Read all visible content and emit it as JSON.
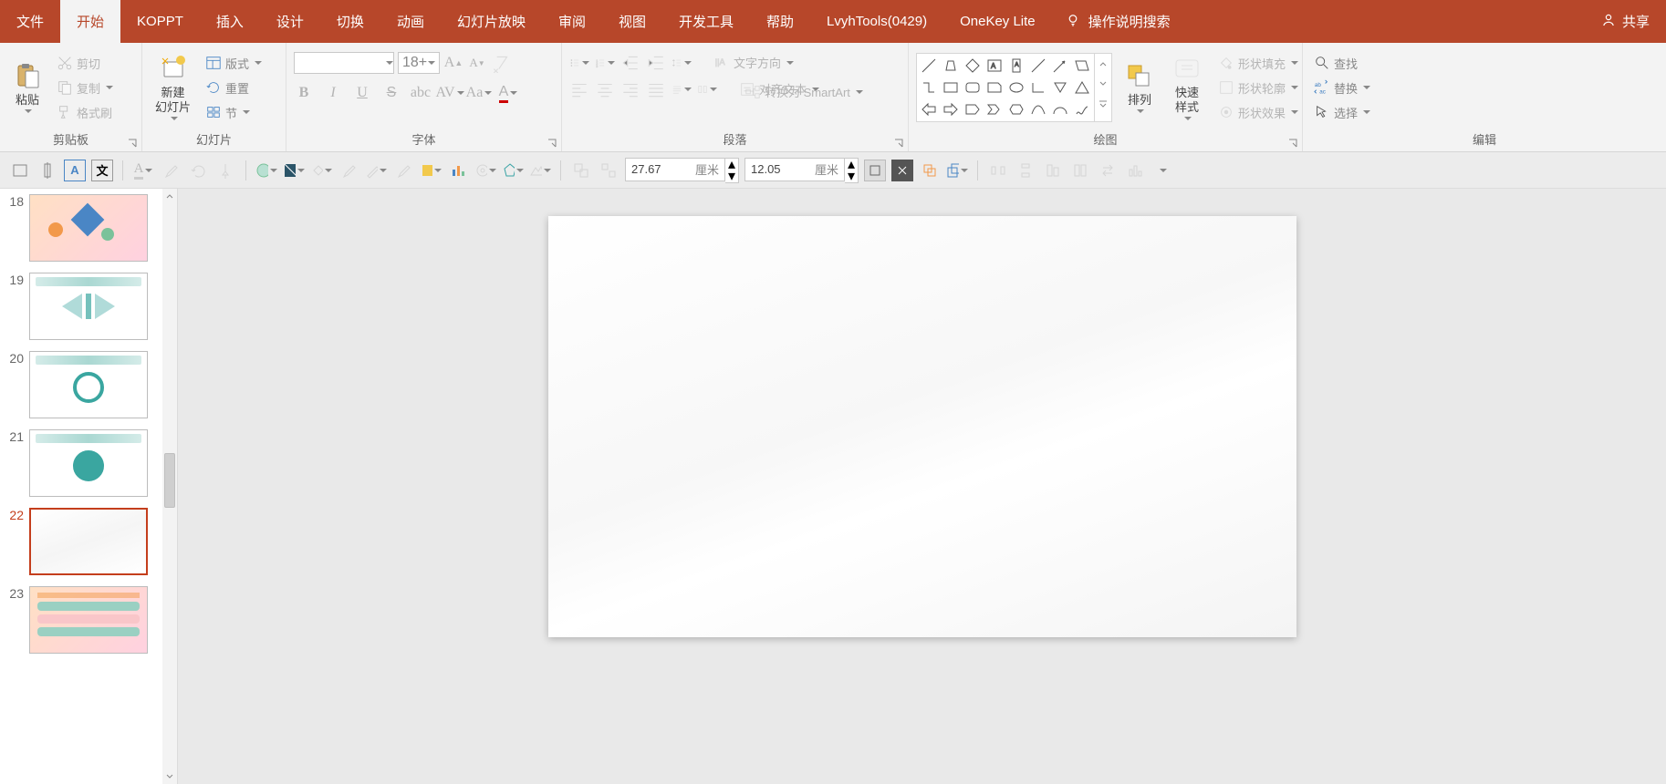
{
  "tabs": {
    "file": "文件",
    "home": "开始",
    "koppt": "KOPPT",
    "insert": "插入",
    "design": "设计",
    "transition": "切换",
    "animation": "动画",
    "slideshow": "幻灯片放映",
    "review": "审阅",
    "view": "视图",
    "devtools": "开发工具",
    "help": "帮助",
    "lvyh": "LvyhTools(0429)",
    "onekey": "OneKey Lite",
    "search_placeholder": "操作说明搜索",
    "share": "共享"
  },
  "ribbon": {
    "clipboard": {
      "label": "剪贴板",
      "paste": "粘贴",
      "cut": "剪切",
      "copy": "复制",
      "format_painter": "格式刷"
    },
    "slides": {
      "label": "幻灯片",
      "new_slide": "新建\n幻灯片",
      "layout": "版式",
      "reset": "重置",
      "section": "节"
    },
    "font": {
      "label": "字体",
      "size_value": "18+"
    },
    "paragraph": {
      "label": "段落",
      "text_direction": "文字方向",
      "align_text": "对齐文本",
      "convert_smartart": "转换为 SmartArt"
    },
    "drawing": {
      "label": "绘图",
      "arrange": "排列",
      "quick_styles": "快速样式",
      "shape_fill": "形状填充",
      "shape_outline": "形状轮廓",
      "shape_effects": "形状效果"
    },
    "editing": {
      "label": "编辑",
      "find": "查找",
      "replace": "替换",
      "select": "选择"
    }
  },
  "toolbar2": {
    "width_value": "27.67",
    "height_value": "12.05",
    "unit": "厘米"
  },
  "slides_panel": {
    "nums": [
      "18",
      "19",
      "20",
      "21",
      "22",
      "23"
    ],
    "selected_index": 4
  }
}
